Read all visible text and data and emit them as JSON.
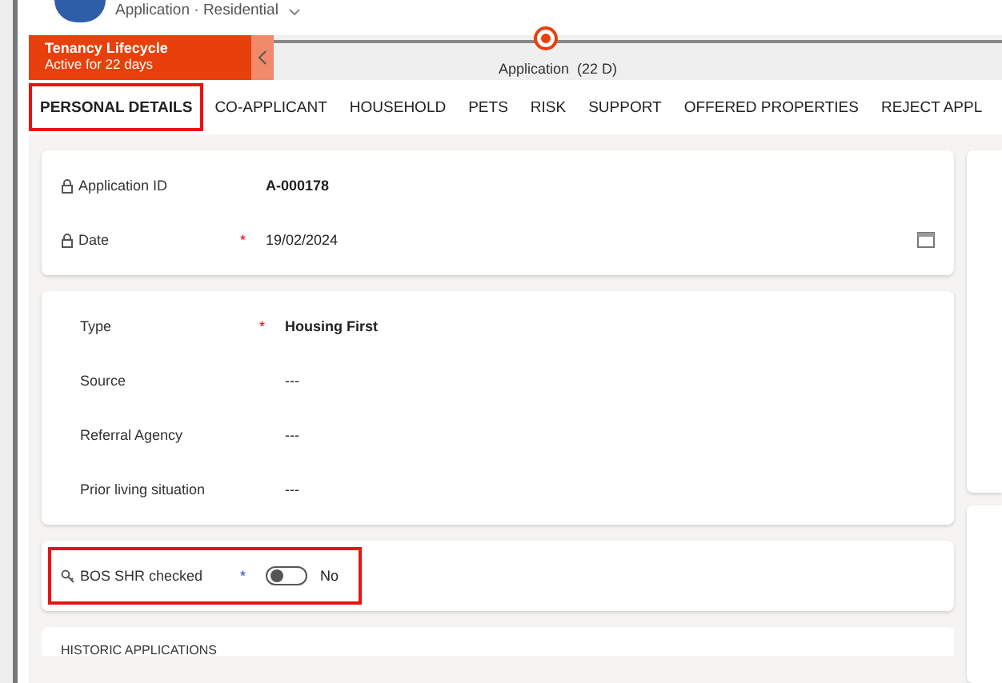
{
  "header": {
    "entity": "Application",
    "separator": "·",
    "form": "Residential"
  },
  "stage_bar": {
    "title": "Tenancy Lifecycle",
    "subtitle": "Active for 22 days",
    "stage": "Application",
    "duration": "(22 D)"
  },
  "tabs": [
    {
      "label": "PERSONAL DETAILS",
      "selected": true,
      "highlighted": true
    },
    {
      "label": "CO-APPLICANT",
      "selected": false,
      "highlighted": false
    },
    {
      "label": "HOUSEHOLD",
      "selected": false,
      "highlighted": false
    },
    {
      "label": "PETS",
      "selected": false,
      "highlighted": false
    },
    {
      "label": "RISK",
      "selected": false,
      "highlighted": false
    },
    {
      "label": "SUPPORT",
      "selected": false,
      "highlighted": false
    },
    {
      "label": "OFFERED PROPERTIES",
      "selected": false,
      "highlighted": false
    },
    {
      "label": "REJECT APPL",
      "selected": false,
      "highlighted": false
    }
  ],
  "sections": [
    {
      "fields": [
        {
          "kind": "locked",
          "label": "Application ID",
          "value": "A-000178",
          "bold": true
        },
        {
          "kind": "date",
          "label": "Date",
          "marker": "*",
          "value": "19/02/2024",
          "bold": false
        }
      ]
    },
    {
      "fields": [
        {
          "kind": "text",
          "label": "Type",
          "marker": "*",
          "value": "Housing First",
          "bold": true
        },
        {
          "kind": "text",
          "label": "Source",
          "value": "---",
          "bold": false
        },
        {
          "kind": "text",
          "label": "Referral Agency",
          "value": "---",
          "bold": false
        },
        {
          "kind": "text",
          "label": "Prior living situation",
          "value": "---",
          "bold": false
        }
      ]
    },
    {
      "fields": [
        {
          "kind": "toggle",
          "label": "BOS SHR checked",
          "marker": "*",
          "on": false,
          "value": "No",
          "bold": false,
          "highlighted": true
        }
      ]
    }
  ],
  "next_section": {
    "title": "HISTORIC APPLICATIONS"
  }
}
